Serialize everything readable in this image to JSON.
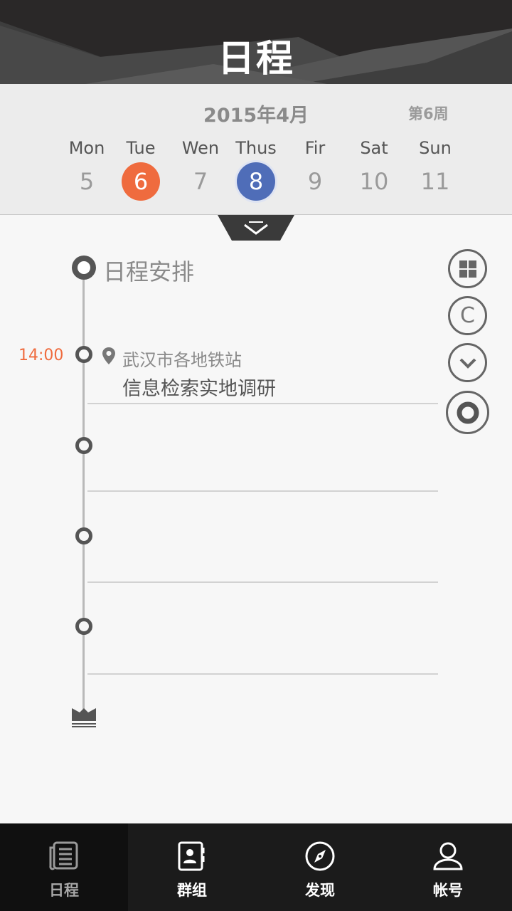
{
  "header": {
    "title": "日程"
  },
  "calendar": {
    "month": "2015年4月",
    "week": "第6周",
    "days": [
      {
        "name": "Mon",
        "num": "5",
        "state": "normal"
      },
      {
        "name": "Tue",
        "num": "6",
        "state": "today"
      },
      {
        "name": "Wen",
        "num": "7",
        "state": "normal"
      },
      {
        "name": "Thus",
        "num": "8",
        "state": "selected"
      },
      {
        "name": "Fir",
        "num": "9",
        "state": "normal"
      },
      {
        "name": "Sat",
        "num": "10",
        "state": "normal"
      },
      {
        "name": "Sun",
        "num": "11",
        "state": "normal"
      }
    ]
  },
  "schedule": {
    "title": "日程安排",
    "events": [
      {
        "time": "14:00",
        "location": "武汉市各地铁站",
        "title": "信息检索实地调研"
      }
    ]
  },
  "side_actions": {
    "grid_icon": "grid-icon",
    "c_label": "C",
    "down_icon": "chevron-down-icon",
    "record_icon": "record-icon"
  },
  "bottom_nav": [
    {
      "label": "日程",
      "icon": "schedule-icon",
      "active": true
    },
    {
      "label": "群组",
      "icon": "contacts-icon",
      "active": false
    },
    {
      "label": "发现",
      "icon": "compass-icon",
      "active": false
    },
    {
      "label": "帐号",
      "icon": "user-icon",
      "active": false
    }
  ],
  "colors": {
    "accent_orange": "#ef6b3e",
    "accent_blue": "#4f6db8",
    "header_dark": "#2b2b2b",
    "nav_dark": "#1b1b1b"
  }
}
